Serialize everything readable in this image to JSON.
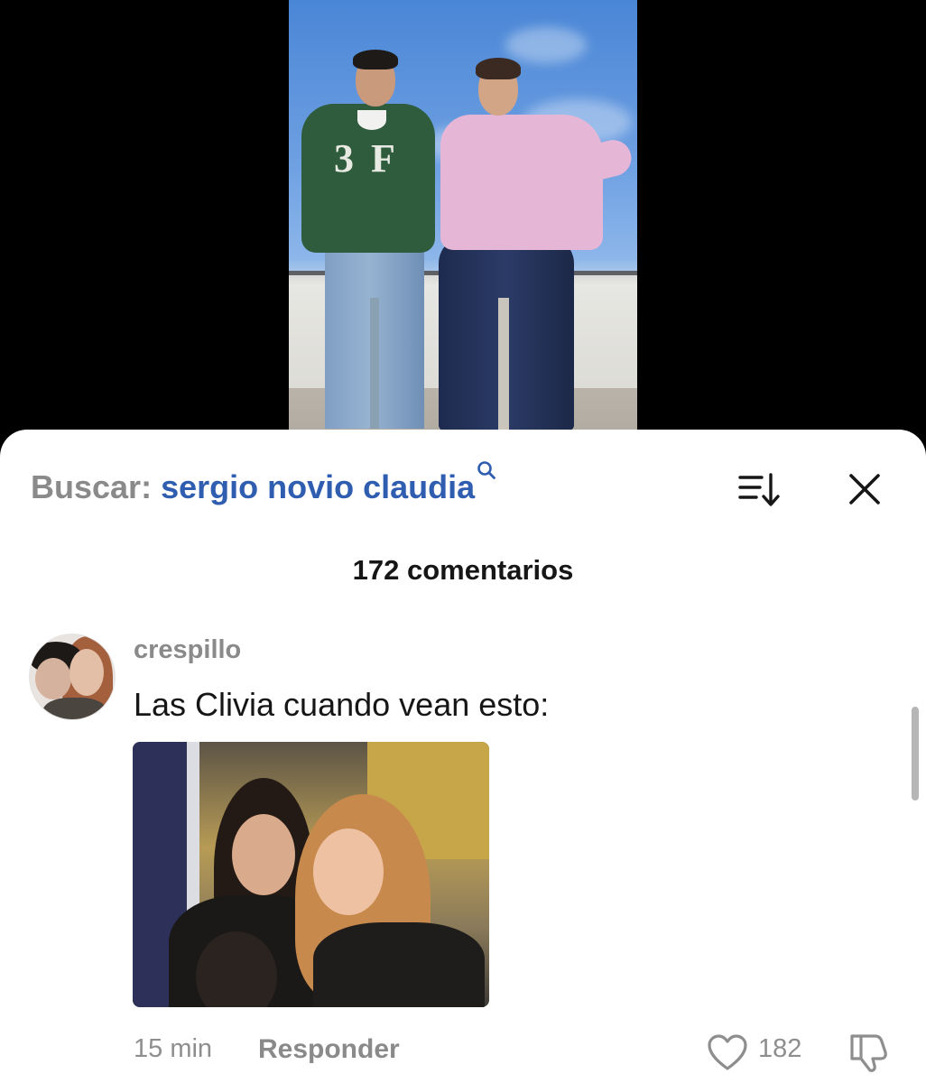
{
  "search": {
    "label": "Buscar:",
    "query": "sergio novio claudia"
  },
  "comments_header": {
    "count_text": "172 comentarios"
  },
  "comment": {
    "username": "crespillo",
    "text": "Las Clivia cuando vean esto:",
    "time": "15 min",
    "reply_label": "Responder",
    "like_count": "182"
  },
  "icons": {
    "search": "search-icon",
    "sort": "sort-icon",
    "close": "close-icon",
    "like": "heart-icon",
    "dislike": "thumbs-down-icon"
  },
  "colors": {
    "query_link": "#2f5db0",
    "muted_text": "#8a8a8a",
    "primary_text": "#161616",
    "sheet_background": "#ffffff"
  }
}
